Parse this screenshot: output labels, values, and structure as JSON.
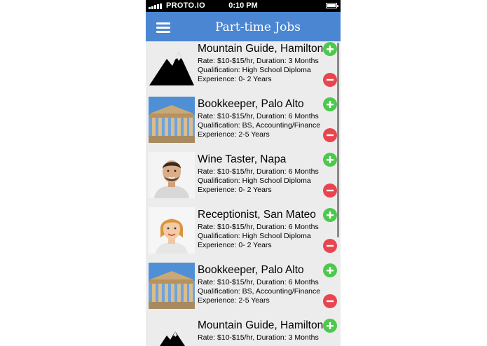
{
  "status_bar": {
    "carrier": "PROTO.IO",
    "time": "0:10 PM"
  },
  "nav": {
    "title": "Part-time Jobs"
  },
  "jobs": [
    {
      "title": "Mountain Guide, Hamilton",
      "rate": "Rate: $10-$15/hr, Duration: 3 Months",
      "qualification": "Qualification: High School Diploma",
      "experience": "Experience: 0- 2 Years",
      "image": "mountain-icon"
    },
    {
      "title": "Bookkeeper, Palo Alto",
      "rate": "Rate: $10-$15/hr, Duration: 6 Months",
      "qualification": "Qualification: BS, Accounting/Finance",
      "experience": "Experience: 2-5 Years",
      "image": "temple-photo"
    },
    {
      "title": "Wine Taster, Napa",
      "rate": "Rate: $10-$15/hr, Duration: 6 Months",
      "qualification": "Qualification: High School Diploma",
      "experience": "Experience: 0- 2 Years",
      "image": "man-portrait-photo"
    },
    {
      "title": "Receptionist, San Mateo",
      "rate": "Rate: $10-$15/hr, Duration: 6 Months",
      "qualification": "Qualification: High School Diploma",
      "experience": "Experience: 0- 2 Years",
      "image": "woman-portrait-photo"
    },
    {
      "title": "Bookkeeper, Palo Alto",
      "rate": "Rate: $10-$15/hr, Duration: 6 Months",
      "qualification": "Qualification: BS, Accounting/Finance",
      "experience": "Experience: 2-5 Years",
      "image": "temple-photo"
    },
    {
      "title": "Mountain Guide, Hamilton",
      "rate": "Rate: $10-$15/hr, Duration: 3 Months",
      "qualification": "",
      "experience": "",
      "image": "mountain-icon"
    }
  ],
  "colors": {
    "nav": "#4a86d2",
    "add": "#4cc94c",
    "remove": "#e8454f",
    "background": "#ececec"
  }
}
